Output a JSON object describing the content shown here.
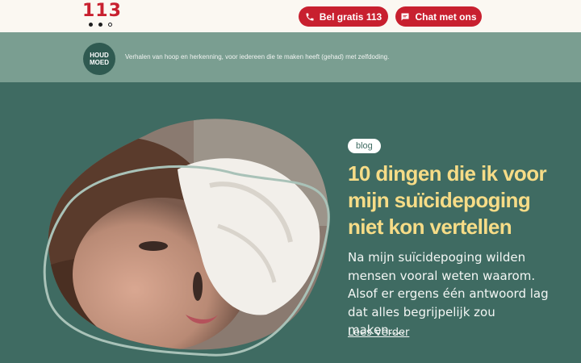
{
  "header": {
    "logo_text": "113",
    "call_label": "Bel gratis 113",
    "chat_label": "Chat met ons"
  },
  "band": {
    "badge_line1": "HOUD",
    "badge_line2": "MOED",
    "tagline": "Verhalen van hoop en herkenning, voor iedereen die te maken heeft (gehad) met zelfdoding."
  },
  "article": {
    "category": "blog",
    "title": "10 dingen die ik voor mijn suïcidepoging niet kon vertellen",
    "excerpt": "Na mijn suïcidepoging wilden mensen vooral weten waarom. Alsof er ergens één antwoord lag dat alles begrijpelijk zou maken.…",
    "read_more": "Lees verder"
  },
  "colors": {
    "brand_red": "#c8202f",
    "dark_green": "#3f6b62",
    "band_green": "#7a9e91",
    "title_yellow": "#f6dc87"
  },
  "icons": {
    "call": "phone-icon",
    "chat": "chat-bubble-icon"
  }
}
